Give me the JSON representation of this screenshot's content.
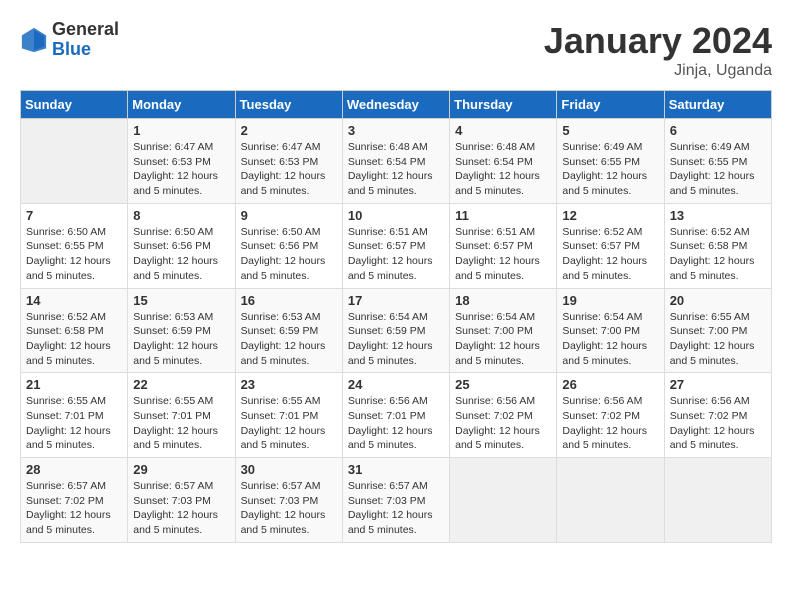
{
  "header": {
    "logo_general": "General",
    "logo_blue": "Blue",
    "title": "January 2024",
    "subtitle": "Jinja, Uganda"
  },
  "weekdays": [
    "Sunday",
    "Monday",
    "Tuesday",
    "Wednesday",
    "Thursday",
    "Friday",
    "Saturday"
  ],
  "weeks": [
    [
      {
        "day": "",
        "sunrise": "",
        "sunset": "",
        "daylight": "",
        "empty": true
      },
      {
        "day": "1",
        "sunrise": "6:47 AM",
        "sunset": "6:53 PM",
        "daylight": "12 hours and 5 minutes.",
        "empty": false
      },
      {
        "day": "2",
        "sunrise": "6:47 AM",
        "sunset": "6:53 PM",
        "daylight": "12 hours and 5 minutes.",
        "empty": false
      },
      {
        "day": "3",
        "sunrise": "6:48 AM",
        "sunset": "6:54 PM",
        "daylight": "12 hours and 5 minutes.",
        "empty": false
      },
      {
        "day": "4",
        "sunrise": "6:48 AM",
        "sunset": "6:54 PM",
        "daylight": "12 hours and 5 minutes.",
        "empty": false
      },
      {
        "day": "5",
        "sunrise": "6:49 AM",
        "sunset": "6:55 PM",
        "daylight": "12 hours and 5 minutes.",
        "empty": false
      },
      {
        "day": "6",
        "sunrise": "6:49 AM",
        "sunset": "6:55 PM",
        "daylight": "12 hours and 5 minutes.",
        "empty": false
      }
    ],
    [
      {
        "day": "7",
        "sunrise": "6:50 AM",
        "sunset": "6:55 PM",
        "daylight": "12 hours and 5 minutes.",
        "empty": false
      },
      {
        "day": "8",
        "sunrise": "6:50 AM",
        "sunset": "6:56 PM",
        "daylight": "12 hours and 5 minutes.",
        "empty": false
      },
      {
        "day": "9",
        "sunrise": "6:50 AM",
        "sunset": "6:56 PM",
        "daylight": "12 hours and 5 minutes.",
        "empty": false
      },
      {
        "day": "10",
        "sunrise": "6:51 AM",
        "sunset": "6:57 PM",
        "daylight": "12 hours and 5 minutes.",
        "empty": false
      },
      {
        "day": "11",
        "sunrise": "6:51 AM",
        "sunset": "6:57 PM",
        "daylight": "12 hours and 5 minutes.",
        "empty": false
      },
      {
        "day": "12",
        "sunrise": "6:52 AM",
        "sunset": "6:57 PM",
        "daylight": "12 hours and 5 minutes.",
        "empty": false
      },
      {
        "day": "13",
        "sunrise": "6:52 AM",
        "sunset": "6:58 PM",
        "daylight": "12 hours and 5 minutes.",
        "empty": false
      }
    ],
    [
      {
        "day": "14",
        "sunrise": "6:52 AM",
        "sunset": "6:58 PM",
        "daylight": "12 hours and 5 minutes.",
        "empty": false
      },
      {
        "day": "15",
        "sunrise": "6:53 AM",
        "sunset": "6:59 PM",
        "daylight": "12 hours and 5 minutes.",
        "empty": false
      },
      {
        "day": "16",
        "sunrise": "6:53 AM",
        "sunset": "6:59 PM",
        "daylight": "12 hours and 5 minutes.",
        "empty": false
      },
      {
        "day": "17",
        "sunrise": "6:54 AM",
        "sunset": "6:59 PM",
        "daylight": "12 hours and 5 minutes.",
        "empty": false
      },
      {
        "day": "18",
        "sunrise": "6:54 AM",
        "sunset": "7:00 PM",
        "daylight": "12 hours and 5 minutes.",
        "empty": false
      },
      {
        "day": "19",
        "sunrise": "6:54 AM",
        "sunset": "7:00 PM",
        "daylight": "12 hours and 5 minutes.",
        "empty": false
      },
      {
        "day": "20",
        "sunrise": "6:55 AM",
        "sunset": "7:00 PM",
        "daylight": "12 hours and 5 minutes.",
        "empty": false
      }
    ],
    [
      {
        "day": "21",
        "sunrise": "6:55 AM",
        "sunset": "7:01 PM",
        "daylight": "12 hours and 5 minutes.",
        "empty": false
      },
      {
        "day": "22",
        "sunrise": "6:55 AM",
        "sunset": "7:01 PM",
        "daylight": "12 hours and 5 minutes.",
        "empty": false
      },
      {
        "day": "23",
        "sunrise": "6:55 AM",
        "sunset": "7:01 PM",
        "daylight": "12 hours and 5 minutes.",
        "empty": false
      },
      {
        "day": "24",
        "sunrise": "6:56 AM",
        "sunset": "7:01 PM",
        "daylight": "12 hours and 5 minutes.",
        "empty": false
      },
      {
        "day": "25",
        "sunrise": "6:56 AM",
        "sunset": "7:02 PM",
        "daylight": "12 hours and 5 minutes.",
        "empty": false
      },
      {
        "day": "26",
        "sunrise": "6:56 AM",
        "sunset": "7:02 PM",
        "daylight": "12 hours and 5 minutes.",
        "empty": false
      },
      {
        "day": "27",
        "sunrise": "6:56 AM",
        "sunset": "7:02 PM",
        "daylight": "12 hours and 5 minutes.",
        "empty": false
      }
    ],
    [
      {
        "day": "28",
        "sunrise": "6:57 AM",
        "sunset": "7:02 PM",
        "daylight": "12 hours and 5 minutes.",
        "empty": false
      },
      {
        "day": "29",
        "sunrise": "6:57 AM",
        "sunset": "7:03 PM",
        "daylight": "12 hours and 5 minutes.",
        "empty": false
      },
      {
        "day": "30",
        "sunrise": "6:57 AM",
        "sunset": "7:03 PM",
        "daylight": "12 hours and 5 minutes.",
        "empty": false
      },
      {
        "day": "31",
        "sunrise": "6:57 AM",
        "sunset": "7:03 PM",
        "daylight": "12 hours and 5 minutes.",
        "empty": false
      },
      {
        "day": "",
        "sunrise": "",
        "sunset": "",
        "daylight": "",
        "empty": true
      },
      {
        "day": "",
        "sunrise": "",
        "sunset": "",
        "daylight": "",
        "empty": true
      },
      {
        "day": "",
        "sunrise": "",
        "sunset": "",
        "daylight": "",
        "empty": true
      }
    ]
  ]
}
